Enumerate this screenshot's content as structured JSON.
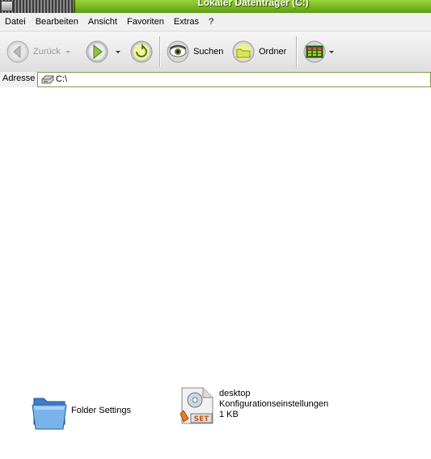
{
  "window": {
    "title": "Lokaler Datenträger (C:)"
  },
  "menu": {
    "items": [
      "Datei",
      "Bearbeiten",
      "Ansicht",
      "Favoriten",
      "Extras",
      "?"
    ]
  },
  "toolbar": {
    "back_label": "Zurück",
    "search_label": "Suchen",
    "folders_label": "Ordner"
  },
  "address": {
    "label": "Adresse",
    "value": "C:\\"
  },
  "files": [
    {
      "name": "Folder Settings",
      "type": "",
      "size": "",
      "icon": "folder-icon"
    },
    {
      "name": "desktop",
      "type": "Konfigurationseinstellungen",
      "size": "1 KB",
      "icon": "settings-file-icon"
    }
  ],
  "colors": {
    "title_active": "#7fbf26",
    "address_border": "#7a9e4a",
    "folder": "#5b9bd5"
  }
}
